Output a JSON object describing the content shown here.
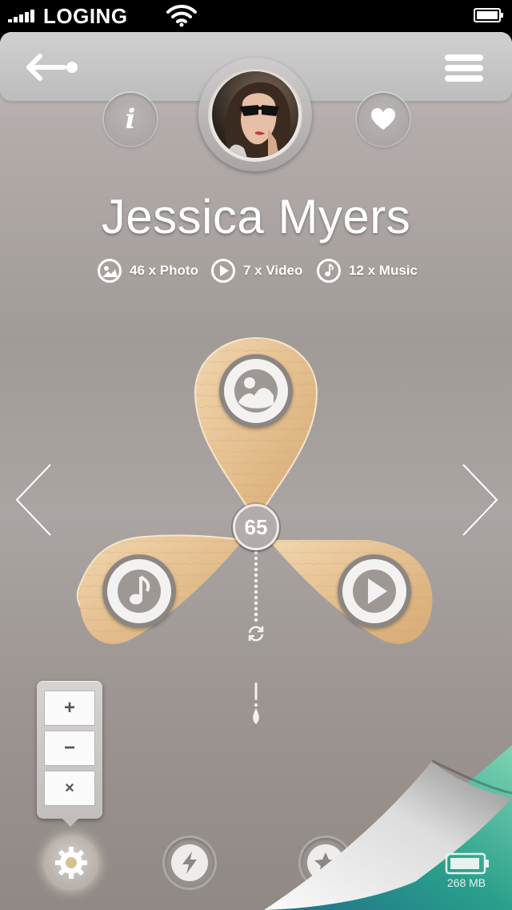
{
  "status_bar": {
    "carrier": "LOGING",
    "signal_bars": 5,
    "wifi": "wifi-icon",
    "battery": "battery-icon"
  },
  "header": {
    "back_icon": "back-arrow-icon",
    "menu_icon": "menu-icon",
    "info_label": "i",
    "favorite_icon": "heart-icon"
  },
  "profile": {
    "name": "Jessica Myers",
    "stats": [
      {
        "label": "46 x Photo",
        "icon": "photo-icon"
      },
      {
        "label": "7 x Video",
        "icon": "play-icon"
      },
      {
        "label": "12 x Music",
        "icon": "music-icon"
      }
    ]
  },
  "media_wheel": {
    "count": "65",
    "petals": [
      {
        "name": "photo",
        "icon": "photo-icon"
      },
      {
        "name": "music",
        "icon": "music-note-icon"
      },
      {
        "name": "video",
        "icon": "play-icon"
      }
    ],
    "refresh_icon": "refresh-icon"
  },
  "zoom_panel": {
    "plus": "+",
    "minus": "−",
    "close": "×"
  },
  "bottom_bar": {
    "settings_icon": "gear-icon",
    "flash_icon": "lightning-icon",
    "favorites_icon": "star-icon",
    "memory": "268 MB"
  },
  "colors": {
    "wood": "#e4bf8f",
    "background": "#a7a09e",
    "curl_accent": "#3fb59a"
  }
}
